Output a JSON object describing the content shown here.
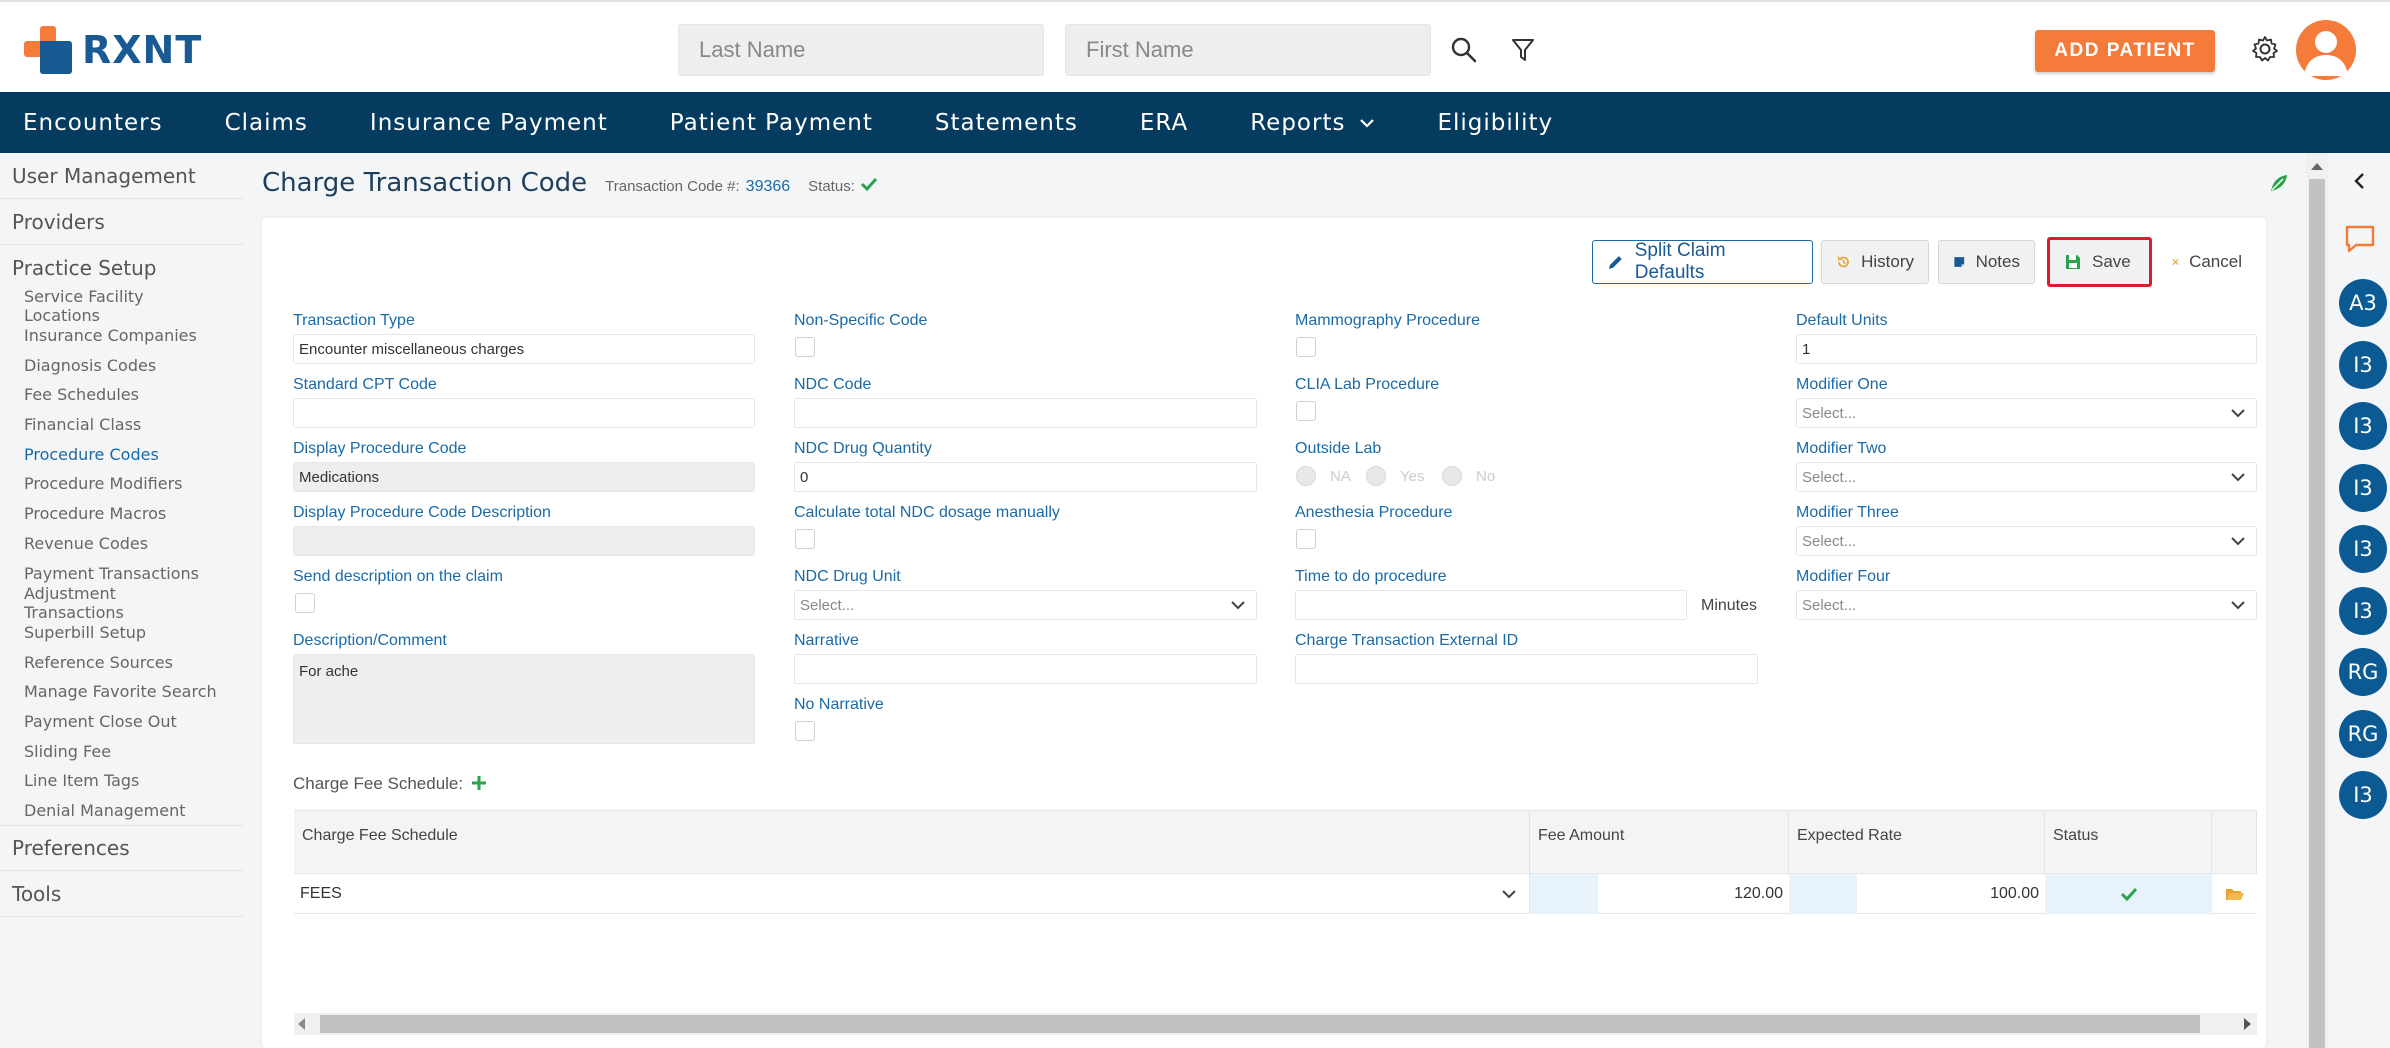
{
  "brand": {
    "name": "RXNT",
    "orange": "#f47b3a",
    "blue": "#1a5a94",
    "navy": "#063b60"
  },
  "search": {
    "last_name_placeholder": "Last Name",
    "first_name_placeholder": "First Name"
  },
  "header_actions": {
    "add_patient": "ADD PATIENT"
  },
  "nav": {
    "items": [
      "Encounters",
      "Claims",
      "Insurance Payment",
      "Patient Payment",
      "Statements",
      "ERA",
      "Reports",
      "Eligibility"
    ]
  },
  "sidebar": {
    "user_management": "User Management",
    "providers": "Providers",
    "practice_setup": "Practice Setup",
    "sub_items": [
      "Service Facility Locations",
      "Insurance Companies",
      "Diagnosis Codes",
      "Fee Schedules",
      "Financial Class",
      "Procedure Codes",
      "Procedure Modifiers",
      "Procedure Macros",
      "Revenue Codes",
      "Payment Transactions",
      "Adjustment Transactions",
      "Superbill Setup",
      "Reference Sources",
      "Manage Favorite Search",
      "Payment Close Out",
      "Sliding Fee",
      "Line Item Tags",
      "Denial Management"
    ],
    "active_sub": "Procedure Codes",
    "preferences": "Preferences",
    "tools": "Tools"
  },
  "page": {
    "title": "Charge Transaction Code",
    "transaction_code_label": "Transaction Code #:",
    "transaction_code": "39366",
    "status_label": "Status:"
  },
  "toolbar": {
    "split": "Split Claim Defaults",
    "history": "History",
    "notes": "Notes",
    "save": "Save",
    "cancel": "Cancel"
  },
  "form": {
    "transaction_type": {
      "label": "Transaction Type",
      "value": "Encounter miscellaneous charges"
    },
    "standard_cpt": {
      "label": "Standard CPT Code",
      "value": ""
    },
    "display_proc_code": {
      "label": "Display Procedure Code",
      "value": "Medications"
    },
    "display_proc_desc": {
      "label": "Display Procedure Code Description",
      "value": ""
    },
    "send_description": {
      "label": "Send description on the claim"
    },
    "description": {
      "label": "Description/Comment",
      "value": "For ache"
    },
    "non_specific": {
      "label": "Non-Specific Code"
    },
    "ndc_code": {
      "label": "NDC Code",
      "value": ""
    },
    "ndc_qty": {
      "label": "NDC Drug Quantity",
      "value": "0"
    },
    "calc_ndc": {
      "label": "Calculate total NDC dosage manually"
    },
    "ndc_unit": {
      "label": "NDC Drug Unit",
      "placeholder": "Select..."
    },
    "narrative": {
      "label": "Narrative",
      "value": ""
    },
    "no_narrative": {
      "label": "No Narrative"
    },
    "mammography": {
      "label": "Mammography Procedure"
    },
    "clia": {
      "label": "CLIA Lab Procedure"
    },
    "outside_lab": {
      "label": "Outside Lab",
      "options": [
        "NA",
        "Yes",
        "No"
      ]
    },
    "anesthesia": {
      "label": "Anesthesia Procedure"
    },
    "time_to_do": {
      "label": "Time to do procedure",
      "value": "",
      "unit": "Minutes"
    },
    "external_id": {
      "label": "Charge Transaction External ID",
      "value": ""
    },
    "default_units": {
      "label": "Default Units",
      "value": "1"
    },
    "modifier_one": {
      "label": "Modifier One",
      "placeholder": "Select..."
    },
    "modifier_two": {
      "label": "Modifier Two",
      "placeholder": "Select..."
    },
    "modifier_three": {
      "label": "Modifier Three",
      "placeholder": "Select..."
    },
    "modifier_four": {
      "label": "Modifier Four",
      "placeholder": "Select..."
    }
  },
  "fee_schedule": {
    "section_label": "Charge Fee Schedule:",
    "columns": [
      "Charge Fee Schedule",
      "Fee Amount",
      "Expected Rate",
      "Status"
    ],
    "rows": [
      {
        "schedule": "FEES",
        "fee_amount": "120.00",
        "expected_rate": "100.00"
      }
    ]
  },
  "right_rail": {
    "badges": [
      "A3",
      "I3",
      "I3",
      "I3",
      "I3",
      "I3",
      "RG",
      "RG",
      "I3"
    ]
  }
}
